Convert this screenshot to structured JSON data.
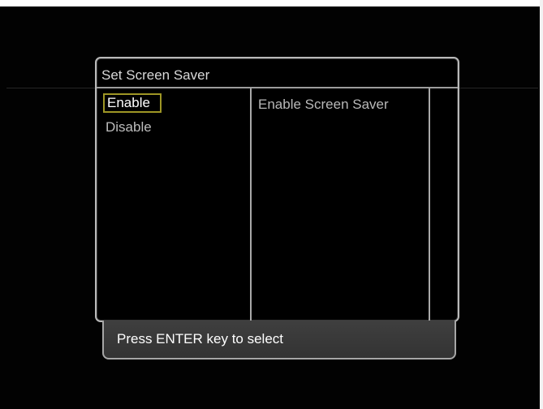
{
  "dialog": {
    "title": "Set Screen Saver",
    "options": [
      {
        "label": "Enable",
        "selected": true
      },
      {
        "label": "Disable",
        "selected": false
      }
    ],
    "description": "Enable Screen Saver"
  },
  "help_bar": {
    "text": "Press ENTER key to select"
  },
  "colors": {
    "background": "#000000",
    "dialog_border": "#b9b9b9",
    "selection_border": "#9e9625",
    "text": "#bdbdbd",
    "help_background": "#3a3a3a"
  }
}
